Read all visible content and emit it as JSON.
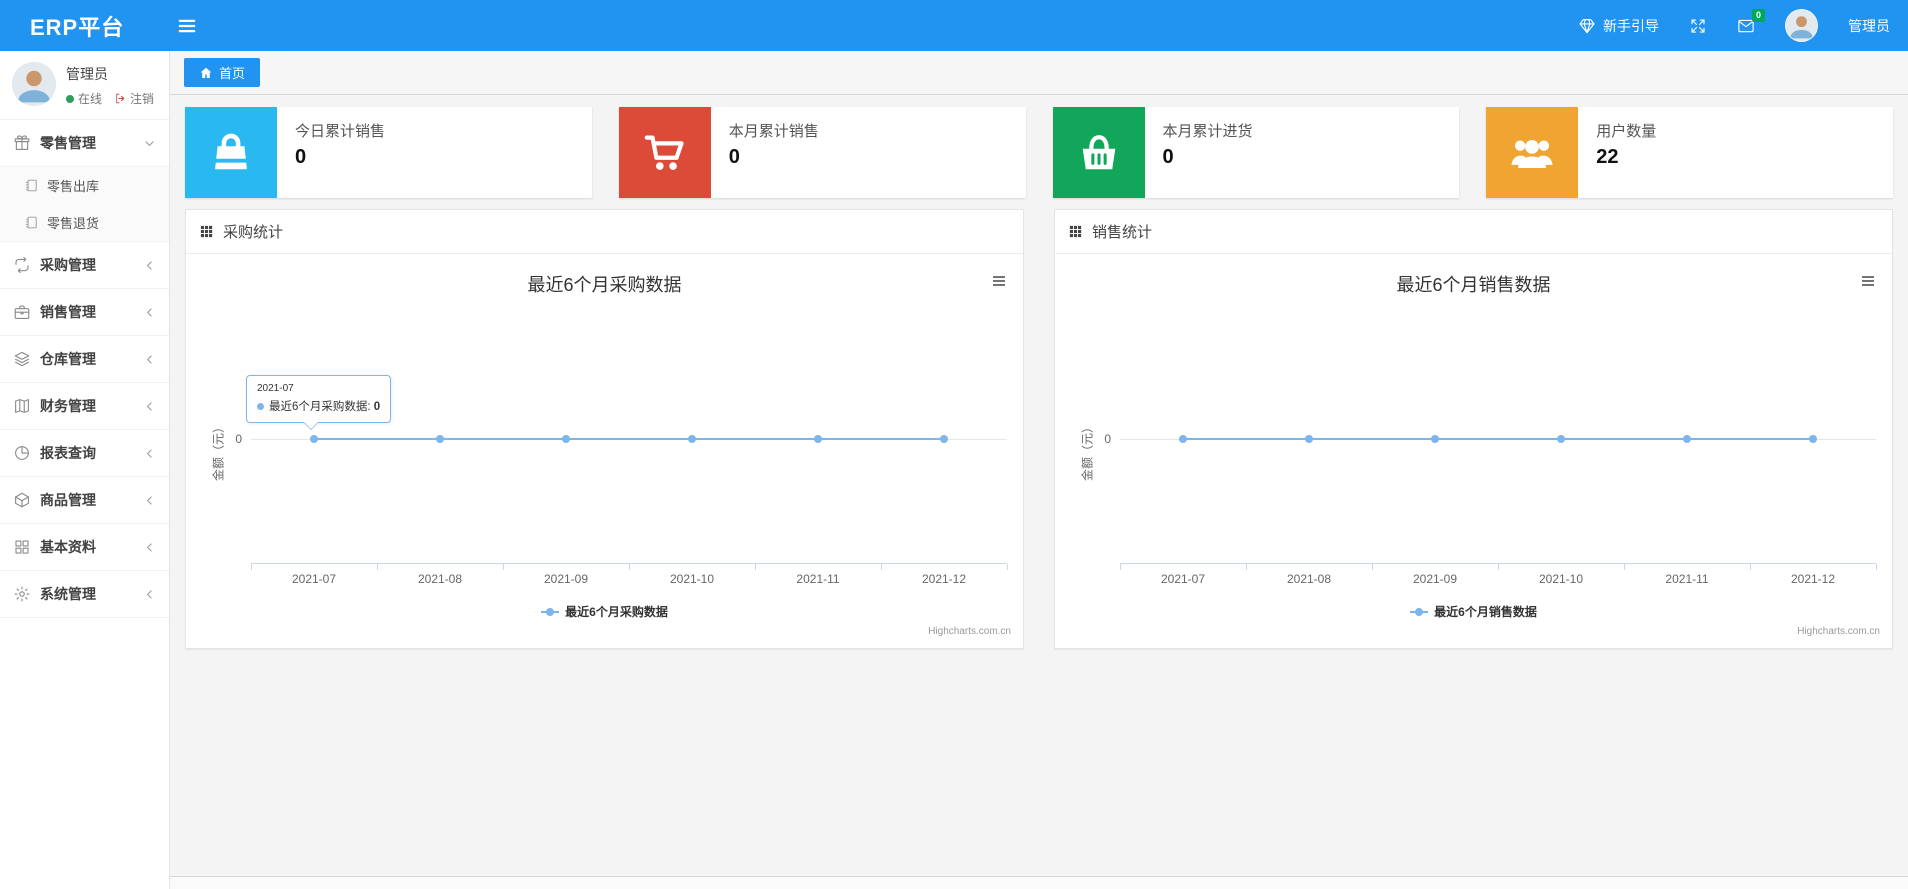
{
  "colors": {
    "navbar_blue": "#2193f0",
    "series_blue": "#7cb5ec",
    "badge_green": "#00a65a"
  },
  "navbar": {
    "brand": "ERP平台",
    "hamburger_icon": "hamburger-icon",
    "guide_icon": "gem-icon",
    "guide_label": "新手引导",
    "fullscreen_icon": "expand-icon",
    "mail_icon": "envelope-icon",
    "mail_badge": "0",
    "avatar_icon": "person-avatar",
    "user_name": "管理员"
  },
  "sidebar": {
    "user": {
      "name": "管理员",
      "status_online": "在线",
      "logout_label": "注销"
    },
    "items": [
      {
        "key": "retail",
        "label": "零售管理",
        "icon": "gift-icon",
        "expanded": true,
        "children": [
          {
            "key": "retail-out",
            "label": "零售出库",
            "icon": "notebook-icon"
          },
          {
            "key": "retail-return",
            "label": "零售退货",
            "icon": "notebook-icon"
          }
        ]
      },
      {
        "key": "purchase",
        "label": "采购管理",
        "icon": "loop-icon"
      },
      {
        "key": "sales",
        "label": "销售管理",
        "icon": "briefcase-icon"
      },
      {
        "key": "warehouse",
        "label": "仓库管理",
        "icon": "layers-icon"
      },
      {
        "key": "finance",
        "label": "财务管理",
        "icon": "ledger-icon"
      },
      {
        "key": "report",
        "label": "报表查询",
        "icon": "pie-chart-icon"
      },
      {
        "key": "goods",
        "label": "商品管理",
        "icon": "box-icon"
      },
      {
        "key": "basic",
        "label": "基本资料",
        "icon": "grid-icon"
      },
      {
        "key": "system",
        "label": "系统管理",
        "icon": "gear-icon"
      }
    ]
  },
  "tabbar": {
    "home_tab": "首页",
    "home_icon": "home-icon"
  },
  "stat_cards": [
    {
      "key": "today-sales",
      "label": "今日累计销售",
      "value": "0",
      "color": "#2ab8f0",
      "icon": "shopping-bag-icon"
    },
    {
      "key": "month-sales",
      "label": "本月累计销售",
      "value": "0",
      "color": "#dc4a38",
      "icon": "cart-icon"
    },
    {
      "key": "month-purchase",
      "label": "本月累计进货",
      "value": "0",
      "color": "#12a65b",
      "icon": "basket-icon"
    },
    {
      "key": "user-count",
      "label": "用户数量",
      "value": "22",
      "color": "#f0a532",
      "icon": "users-icon"
    }
  ],
  "chart_data": [
    {
      "key": "purchase-stats",
      "type": "line",
      "panel_title": "采购统计",
      "title": "最近6个月采购数据",
      "categories": [
        "2021-07",
        "2021-08",
        "2021-09",
        "2021-10",
        "2021-11",
        "2021-12"
      ],
      "series": [
        {
          "name": "最近6个月采购数据",
          "values": [
            0,
            0,
            0,
            0,
            0,
            0
          ]
        }
      ],
      "ylabel": "金额（元）",
      "yticks": [
        "0"
      ],
      "ylim": [
        -1,
        1
      ],
      "grid": true,
      "legend_position": "bottom",
      "color": "#7cb5ec",
      "credit": "Highcharts.com.cn",
      "tooltip": {
        "header": "2021-07",
        "label": "最近6个月采购数据",
        "value": "0"
      }
    },
    {
      "key": "sales-stats",
      "type": "line",
      "panel_title": "销售统计",
      "title": "最近6个月销售数据",
      "categories": [
        "2021-07",
        "2021-08",
        "2021-09",
        "2021-10",
        "2021-11",
        "2021-12"
      ],
      "series": [
        {
          "name": "最近6个月销售数据",
          "values": [
            0,
            0,
            0,
            0,
            0,
            0
          ]
        }
      ],
      "ylabel": "金额（元）",
      "yticks": [
        "0"
      ],
      "ylim": [
        -1,
        1
      ],
      "grid": true,
      "legend_position": "bottom",
      "color": "#7cb5ec",
      "credit": "Highcharts.com.cn",
      "tooltip": null
    }
  ]
}
